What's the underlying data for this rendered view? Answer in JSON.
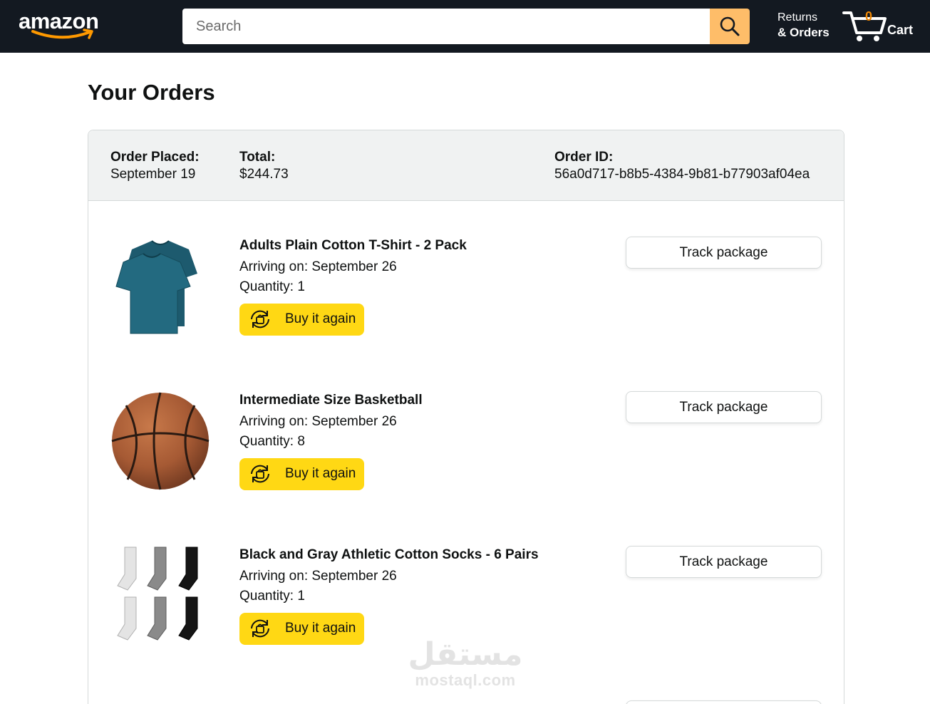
{
  "header": {
    "logo_text": "amazon",
    "search_placeholder": "Search",
    "returns_top": "Returns",
    "returns_bottom": "& Orders",
    "cart_count": "0",
    "cart_label": "Cart",
    "colors": {
      "bar": "#131921",
      "search_button": "#febd69",
      "cart_count": "#f08804"
    }
  },
  "page": {
    "title": "Your Orders"
  },
  "order": {
    "placed_label": "Order Placed:",
    "placed_value": "September 19",
    "total_label": "Total:",
    "total_value": "$244.73",
    "id_label": "Order ID:",
    "id_value": "56a0d717-b8b5-4384-9b81-b77903af04ea",
    "items": [
      {
        "name": "Adults Plain Cotton T-Shirt - 2 Pack",
        "arriving": "Arriving on: September 26",
        "quantity": "Quantity: 1",
        "buy_again": "Buy it again",
        "track": "Track package",
        "image_icon": "tshirt-image"
      },
      {
        "name": "Intermediate Size Basketball",
        "arriving": "Arriving on: September 26",
        "quantity": "Quantity: 8",
        "buy_again": "Buy it again",
        "track": "Track package",
        "image_icon": "basketball-image"
      },
      {
        "name": "Black and Gray Athletic Cotton Socks - 6 Pairs",
        "arriving": "Arriving on: September 26",
        "quantity": "Quantity: 1",
        "buy_again": "Buy it again",
        "track": "Track package",
        "image_icon": "socks-image"
      }
    ]
  },
  "watermark": {
    "arabic": "مستقل",
    "latin": "mostaql.com"
  },
  "colors": {
    "buy_again": "#ffd814",
    "order_header_bg": "#f0f2f2"
  }
}
